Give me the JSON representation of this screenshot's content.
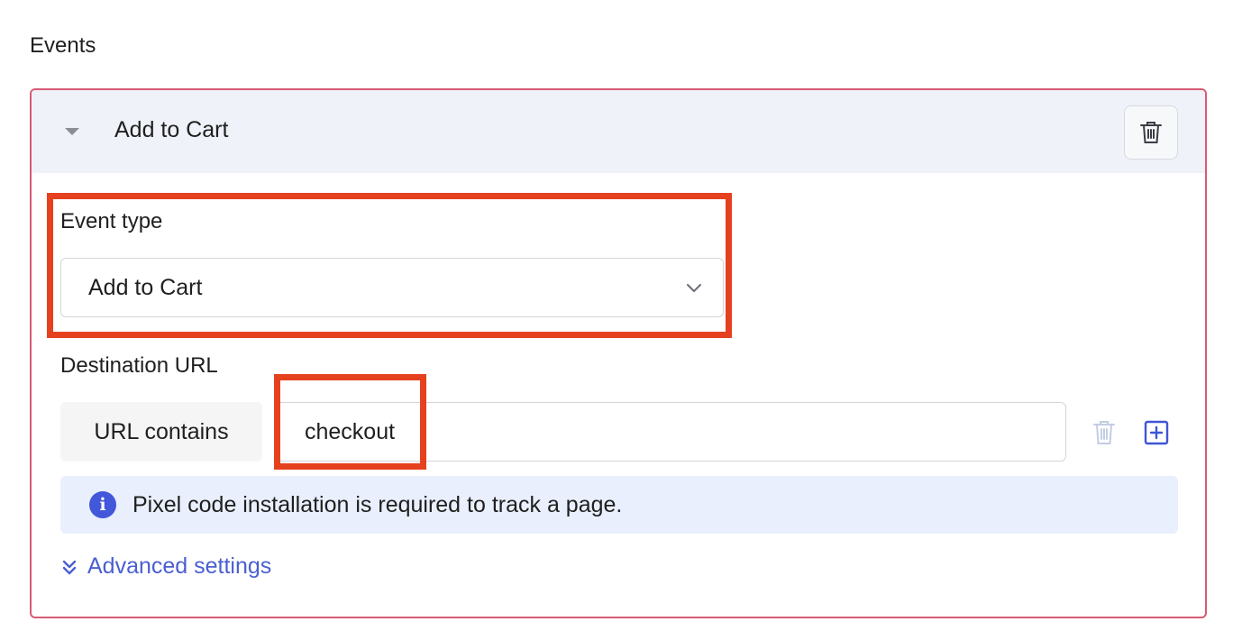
{
  "section": {
    "title": "Events"
  },
  "event_card": {
    "header_title": "Add to Cart",
    "event_type": {
      "label": "Event type",
      "selected_value": "Add to Cart"
    },
    "destination_url": {
      "label": "Destination URL",
      "prefix": "URL contains",
      "value": "checkout"
    },
    "info": {
      "text": "Pixel code installation is required to track a page."
    },
    "advanced_settings_label": "Advanced settings"
  },
  "colors": {
    "card_border": "#d75b74",
    "header_bg": "#eff2f8",
    "accent_blue": "#4a5fd0",
    "info_bg": "#e9effc",
    "highlight": "#e6411f"
  },
  "icons": {
    "collapse": "caret-down-icon",
    "header_delete": "trash-icon",
    "select": "chevron-down-icon",
    "url_delete": "trash-icon",
    "url_add": "plus-square-icon",
    "info": "info-icon",
    "advanced": "double-chevron-down-icon"
  }
}
